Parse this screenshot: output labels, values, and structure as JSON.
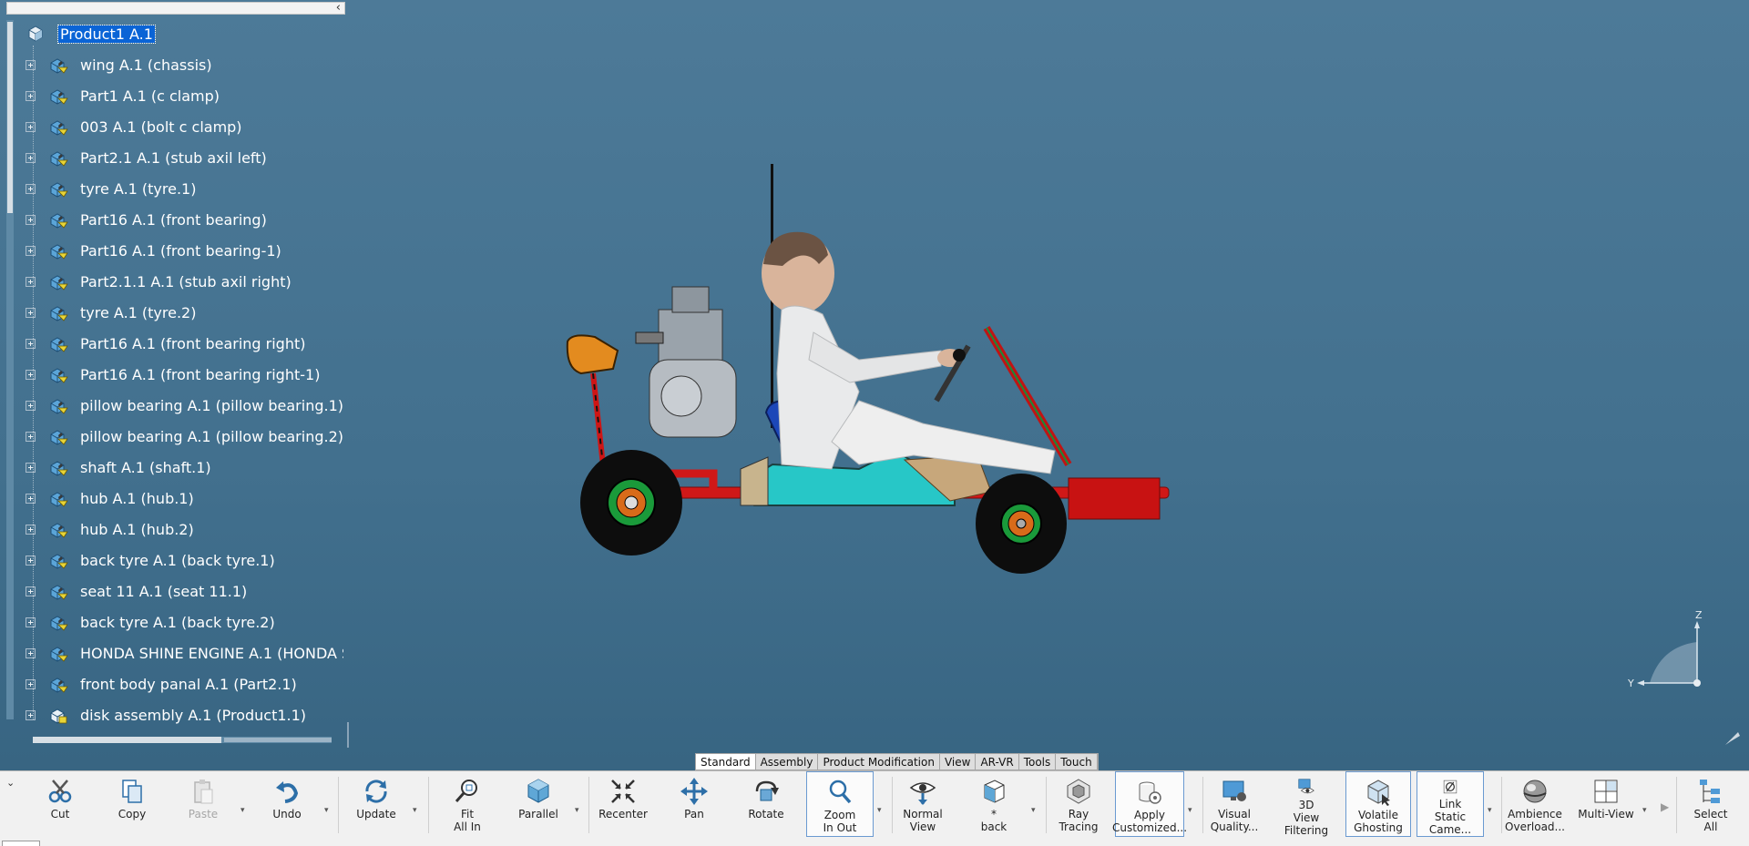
{
  "tree": {
    "root_label": "Product1 A.1",
    "items": [
      {
        "label": "wing A.1 (chassis)",
        "icon": "part-icon"
      },
      {
        "label": "Part1 A.1 (c clamp)",
        "icon": "part-icon"
      },
      {
        "label": "003 A.1 (bolt c clamp)",
        "icon": "part-icon"
      },
      {
        "label": "Part2.1 A.1 (stub axil left)",
        "icon": "part-icon"
      },
      {
        "label": "tyre A.1 (tyre.1)",
        "icon": "part-icon"
      },
      {
        "label": "Part16 A.1 (front bearing)",
        "icon": "part-icon"
      },
      {
        "label": "Part16 A.1 (front bearing-1)",
        "icon": "part-icon"
      },
      {
        "label": "Part2.1.1 A.1 (stub axil right)",
        "icon": "part-icon"
      },
      {
        "label": "tyre A.1 (tyre.2)",
        "icon": "part-icon"
      },
      {
        "label": "Part16 A.1 (front bearing right)",
        "icon": "part-icon"
      },
      {
        "label": "Part16 A.1 (front bearing right-1)",
        "icon": "part-icon"
      },
      {
        "label": "pillow bearing A.1 (pillow bearing.1)",
        "icon": "part-icon"
      },
      {
        "label": "pillow bearing A.1 (pillow bearing.2)",
        "icon": "part-icon"
      },
      {
        "label": "shaft A.1 (shaft.1)",
        "icon": "part-icon"
      },
      {
        "label": "hub A.1 (hub.1)",
        "icon": "part-icon"
      },
      {
        "label": "hub A.1 (hub.2)",
        "icon": "part-icon"
      },
      {
        "label": "back tyre A.1 (back tyre.1)",
        "icon": "part-icon"
      },
      {
        "label": "seat 11 A.1 (seat 11.1)",
        "icon": "part-icon"
      },
      {
        "label": "back tyre A.1 (back tyre.2)",
        "icon": "part-icon"
      },
      {
        "label": "HONDA SHINE ENGINE A.1 (HONDA S",
        "icon": "part-icon"
      },
      {
        "label": "front body panal A.1 (Part2.1)",
        "icon": "part-icon"
      },
      {
        "label": "disk assembly A.1 (Product1.1)",
        "icon": "product-icon"
      }
    ]
  },
  "compass": {
    "z": "Z",
    "y": "Y"
  },
  "tabs": [
    {
      "label": "Standard",
      "active": true
    },
    {
      "label": "Assembly",
      "active": false
    },
    {
      "label": "Product Modification",
      "active": false
    },
    {
      "label": "View",
      "active": false
    },
    {
      "label": "AR-VR",
      "active": false
    },
    {
      "label": "Tools",
      "active": false
    },
    {
      "label": "Touch",
      "active": false
    }
  ],
  "toolbar": {
    "cut": "Cut",
    "copy": "Copy",
    "paste": "Paste",
    "undo": "Undo",
    "update": "Update",
    "fit_all_in": "Fit\nAll In",
    "parallel": "Parallel",
    "recenter": "Recenter",
    "pan": "Pan",
    "rotate": "Rotate",
    "zoom_in_out": "Zoom\nIn Out",
    "normal_view": "Normal\nView",
    "back": "*\nback",
    "ray_tracing": "Ray\nTracing",
    "apply_customized": "Apply\nCustomized...",
    "visual_quality": "Visual\nQuality...",
    "view_filtering": "3D\nView Filtering",
    "volatile_ghosting": "Volatile\nGhosting",
    "link_static_camera": "Link\nStatic Came...",
    "ambience_overload": "Ambience\nOverload...",
    "multi_view": "Multi-View",
    "select_all": "Select\nAll"
  },
  "colors": {
    "viewport_bg": "#46738f",
    "selection": "#0a64d6",
    "chassis_red": "#d01818",
    "body_cyan": "#27c7c7",
    "seat_blue": "#1c47b8"
  }
}
